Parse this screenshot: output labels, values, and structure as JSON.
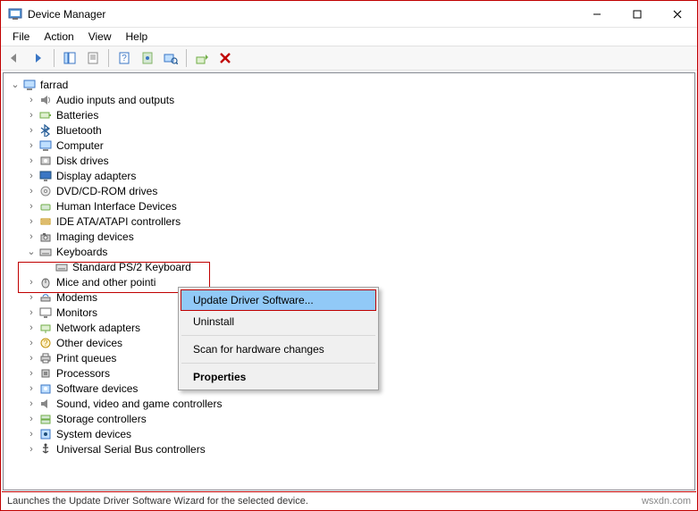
{
  "window": {
    "title": "Device Manager"
  },
  "menu": {
    "file": "File",
    "action": "Action",
    "view": "View",
    "help": "Help"
  },
  "toolbar_icons": {
    "back": "back-arrow",
    "forward": "forward-arrow",
    "show_hide": "show-hide-tree",
    "properties": "properties",
    "help": "help",
    "help2": "help-sheet",
    "scan": "scan-hardware",
    "update": "update-driver",
    "uninstall": "uninstall-x"
  },
  "tree": {
    "root": "farrad",
    "items": [
      {
        "label": "Audio inputs and outputs",
        "icon": "speaker-icon"
      },
      {
        "label": "Batteries",
        "icon": "battery-icon"
      },
      {
        "label": "Bluetooth",
        "icon": "bluetooth-icon"
      },
      {
        "label": "Computer",
        "icon": "computer-icon"
      },
      {
        "label": "Disk drives",
        "icon": "disk-icon"
      },
      {
        "label": "Display adapters",
        "icon": "display-icon"
      },
      {
        "label": "DVD/CD-ROM drives",
        "icon": "optical-icon"
      },
      {
        "label": "Human Interface Devices",
        "icon": "hid-icon"
      },
      {
        "label": "IDE ATA/ATAPI controllers",
        "icon": "ide-icon"
      },
      {
        "label": "Imaging devices",
        "icon": "camera-icon"
      },
      {
        "label": "Keyboards",
        "icon": "keyboard-icon",
        "expanded": true,
        "children": [
          {
            "label": "Standard PS/2 Keyboard",
            "icon": "keyboard-icon"
          }
        ]
      },
      {
        "label": "Mice and other pointing devices",
        "icon": "mouse-icon",
        "truncated": "Mice and other pointi"
      },
      {
        "label": "Modems",
        "icon": "modem-icon"
      },
      {
        "label": "Monitors",
        "icon": "monitor-icon"
      },
      {
        "label": "Network adapters",
        "icon": "network-icon"
      },
      {
        "label": "Other devices",
        "icon": "other-icon"
      },
      {
        "label": "Print queues",
        "icon": "printer-icon"
      },
      {
        "label": "Processors",
        "icon": "cpu-icon"
      },
      {
        "label": "Software devices",
        "icon": "software-icon"
      },
      {
        "label": "Sound, video and game controllers",
        "icon": "sound-icon"
      },
      {
        "label": "Storage controllers",
        "icon": "storage-icon"
      },
      {
        "label": "System devices",
        "icon": "system-icon"
      },
      {
        "label": "Universal Serial Bus controllers",
        "icon": "usb-icon"
      }
    ]
  },
  "context_menu": {
    "update": "Update Driver Software...",
    "uninstall": "Uninstall",
    "scan": "Scan for hardware changes",
    "properties": "Properties"
  },
  "status": {
    "left": "Launches the Update Driver Software Wizard for the selected device.",
    "right": "wsxdn.com"
  }
}
